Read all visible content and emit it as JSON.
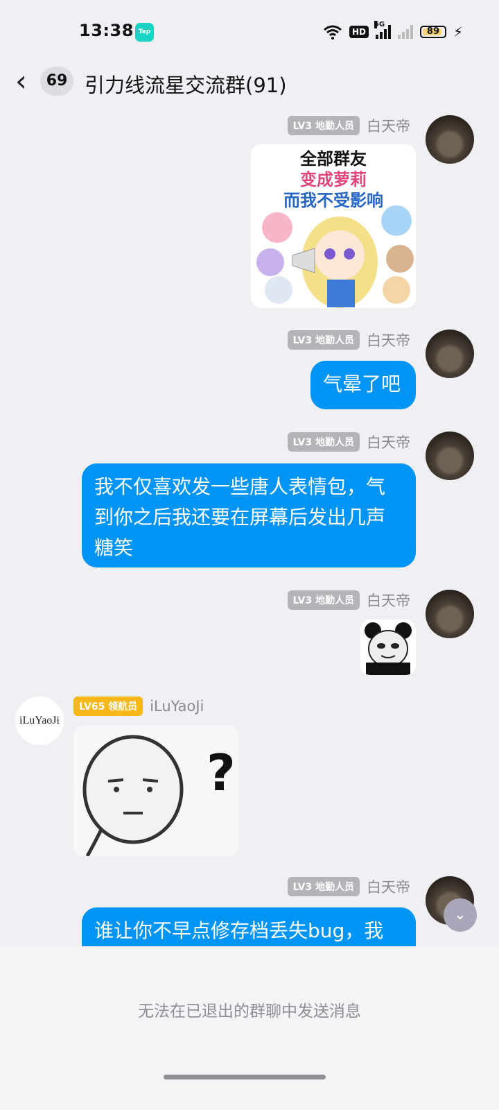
{
  "status_bar": {
    "time": "13:38",
    "app_icon": "Tap",
    "hd": "HD",
    "network": "5G",
    "battery": "89"
  },
  "header": {
    "unread_count": "69",
    "title": "引力线流星交流群(91)"
  },
  "messages": [
    {
      "badge": "LV3 地勤人员",
      "nick": "白天帝",
      "type": "sticker",
      "sticker_text": [
        "全部群友",
        "变成萝莉",
        "而我不受影响"
      ]
    },
    {
      "badge": "LV3 地勤人员",
      "nick": "白天帝",
      "type": "text",
      "text": "气晕了吧"
    },
    {
      "badge": "LV3 地勤人员",
      "nick": "白天帝",
      "type": "text",
      "text": "我不仅喜欢发一些唐人表情包，气到你之后我还要在屏幕后发出几声糖笑"
    },
    {
      "badge": "LV3 地勤人员",
      "nick": "白天帝",
      "type": "sticker"
    },
    {
      "badge": "LV65 领航员",
      "nick": "iLuYaoJi",
      "type": "sticker",
      "avatar_text": "iLuYaoJi",
      "sticker_text": "?"
    },
    {
      "badge": "LV3 地勤人员",
      "nick": "白天帝",
      "type": "text",
      "text": "谁让你不早点修存档丢失bug，我"
    }
  ],
  "footer": {
    "notice": "无法在已退出的群聊中发送消息"
  },
  "colors": {
    "bubble": "#0094f5",
    "badge_gold": "#f7b719",
    "badge_gray": "#b3b3b8"
  }
}
